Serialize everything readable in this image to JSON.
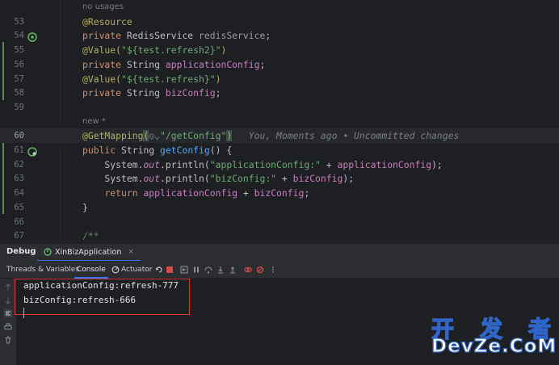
{
  "editor": {
    "lines": [
      {
        "num": "",
        "hint": "no usages"
      },
      {
        "num": "53",
        "parts": [
          {
            "t": "@Resource",
            "c": "ann"
          }
        ]
      },
      {
        "num": "54",
        "parts": [
          {
            "t": "private ",
            "c": "kw"
          },
          {
            "t": "RedisService ",
            "c": "plain"
          },
          {
            "t": "redisService",
            "c": "greyid"
          },
          {
            "t": ";",
            "c": "plain"
          }
        ]
      },
      {
        "num": "55",
        "parts": [
          {
            "t": "@Value(",
            "c": "ann"
          },
          {
            "t": "\"${test.refresh2}\"",
            "c": "str"
          },
          {
            "t": ")",
            "c": "ann"
          }
        ]
      },
      {
        "num": "56",
        "parts": [
          {
            "t": "private ",
            "c": "kw"
          },
          {
            "t": "String ",
            "c": "plain"
          },
          {
            "t": "applicationConfig",
            "c": "fld"
          },
          {
            "t": ";",
            "c": "plain"
          }
        ]
      },
      {
        "num": "57",
        "parts": [
          {
            "t": "@Value(",
            "c": "ann"
          },
          {
            "t": "\"${test.refresh}\"",
            "c": "str"
          },
          {
            "t": ")",
            "c": "ann"
          }
        ]
      },
      {
        "num": "58",
        "parts": [
          {
            "t": "private ",
            "c": "kw"
          },
          {
            "t": "String ",
            "c": "plain"
          },
          {
            "t": "bizConfig",
            "c": "fld"
          },
          {
            "t": ";",
            "c": "plain"
          }
        ]
      },
      {
        "num": "59",
        "parts": []
      },
      {
        "num": "",
        "hint": "new *"
      },
      {
        "num": "60",
        "parts": [
          {
            "t": "@GetMapping",
            "c": "ann"
          },
          {
            "t": "(",
            "c": "ann paren-hl"
          },
          {
            "t": "◎⌄",
            "c": "inlay"
          },
          {
            "t": "\"/getConfig\"",
            "c": "str"
          },
          {
            "t": ")",
            "c": "ann paren-hl"
          },
          {
            "t": "   You, Moments ago • Uncommitted changes",
            "c": "inlay"
          }
        ]
      },
      {
        "num": "61",
        "parts": [
          {
            "t": "public ",
            "c": "kw"
          },
          {
            "t": "String ",
            "c": "plain"
          },
          {
            "t": "getConfig",
            "c": "mth"
          },
          {
            "t": "() {",
            "c": "plain"
          }
        ]
      },
      {
        "num": "62",
        "parts": [
          {
            "t": "    System.",
            "c": "plain"
          },
          {
            "t": "out",
            "c": "sfld"
          },
          {
            "t": ".println(",
            "c": "plain"
          },
          {
            "t": "\"applicationConfig:\"",
            "c": "str"
          },
          {
            "t": " + ",
            "c": "plain"
          },
          {
            "t": "applicationConfig",
            "c": "fld"
          },
          {
            "t": ");",
            "c": "plain"
          }
        ]
      },
      {
        "num": "63",
        "parts": [
          {
            "t": "    System.",
            "c": "plain"
          },
          {
            "t": "out",
            "c": "sfld"
          },
          {
            "t": ".println(",
            "c": "plain"
          },
          {
            "t": "\"bizConfig:\"",
            "c": "str"
          },
          {
            "t": " + ",
            "c": "plain"
          },
          {
            "t": "bizConfig",
            "c": "fld"
          },
          {
            "t": ");",
            "c": "plain"
          }
        ]
      },
      {
        "num": "64",
        "parts": [
          {
            "t": "    ",
            "c": "plain"
          },
          {
            "t": "return ",
            "c": "kw"
          },
          {
            "t": "applicationConfig",
            "c": "fld"
          },
          {
            "t": " + ",
            "c": "plain"
          },
          {
            "t": "bizConfig",
            "c": "fld"
          },
          {
            "t": ";",
            "c": "plain"
          }
        ]
      },
      {
        "num": "65",
        "parts": [
          {
            "t": "}",
            "c": "plain"
          }
        ]
      },
      {
        "num": "66",
        "parts": []
      },
      {
        "num": "67",
        "parts": [
          {
            "t": "/**",
            "c": "cmt"
          }
        ]
      }
    ]
  },
  "debug": {
    "title": "Debug",
    "session_tab": "XinBizApplication",
    "session_close": "×",
    "tabs": {
      "threads": "Threads & Variables",
      "console": "Console",
      "actuator": "Actuator"
    }
  },
  "console": {
    "lines": [
      "applicationConfig:refresh-777",
      "bizConfig:refresh-666"
    ]
  },
  "watermark": {
    "cn": [
      "开",
      "发",
      "者"
    ],
    "en": "DevZe.CoM"
  },
  "colors": {
    "accent": "#3574f0",
    "highlight_frame": "#d43a3a"
  }
}
